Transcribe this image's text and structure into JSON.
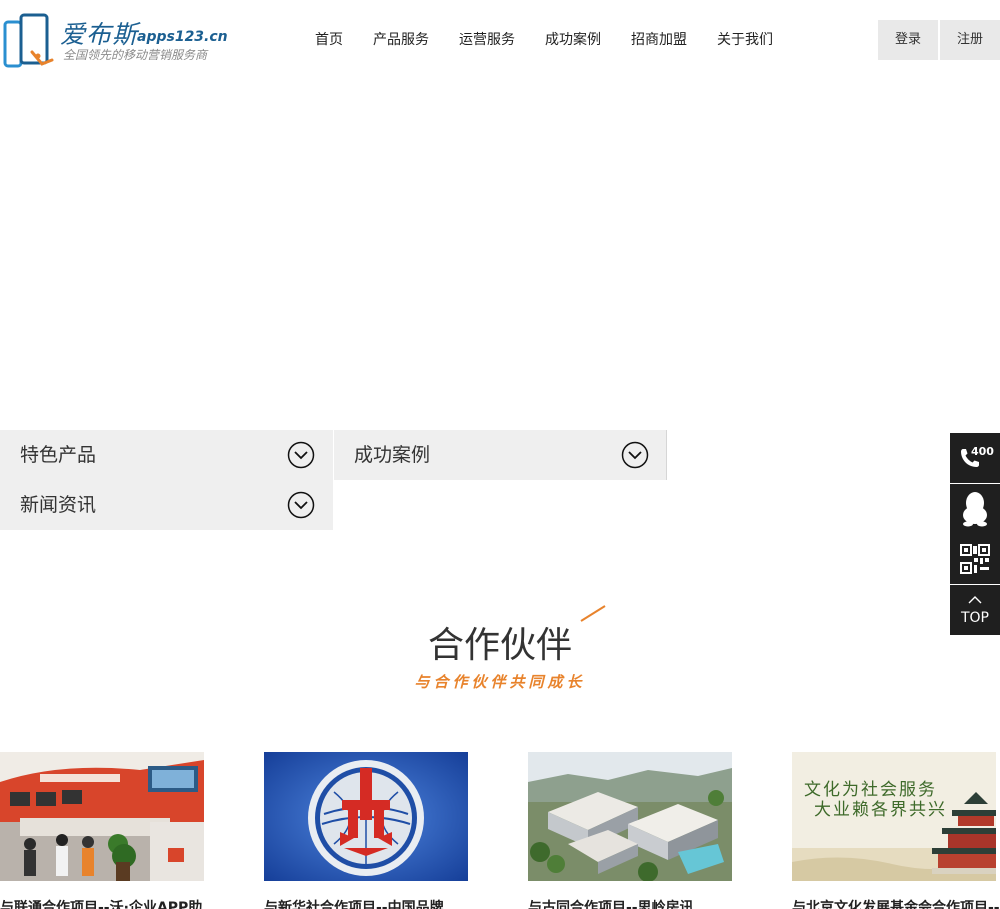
{
  "brand": {
    "name": "爱布斯",
    "domain": "apps123.cn",
    "slogan": "全国领先的移动营销服务商",
    "primary_color": "#1b5f91",
    "accent_color": "#e8832c"
  },
  "nav": [
    {
      "label": "首页"
    },
    {
      "label": "产品服务"
    },
    {
      "label": "运营服务"
    },
    {
      "label": "成功案例"
    },
    {
      "label": "招商加盟"
    },
    {
      "label": "关于我们"
    }
  ],
  "auth": {
    "login": "登录",
    "register": "注册"
  },
  "tabs": [
    {
      "label": "特色产品",
      "icon": "chevron-down-icon"
    },
    {
      "label": "成功案例",
      "icon": "chevron-down-icon"
    },
    {
      "label": "新闻资讯",
      "icon": "chevron-down-icon"
    }
  ],
  "float_bar": {
    "phone": {
      "icon": "phone-icon",
      "text": "400"
    },
    "qq": {
      "icon": "qq-penguin-icon"
    },
    "qr": {
      "icon": "qr-code-icon"
    },
    "top": {
      "icon": "arrow-up-icon",
      "text": "TOP"
    }
  },
  "partners": {
    "title": "合作伙伴",
    "subtitle": "与合作伙伴共同成长",
    "cards": [
      {
        "title": "与联通合作项目--沃·企业APP助"
      },
      {
        "title": "与新华社合作项目--中国品牌"
      },
      {
        "title": "与古同合作项目--思岭房讯"
      },
      {
        "title": "与北京文化发展基金会合作项目--",
        "image_text_1": "文化为社会服务",
        "image_text_2": "大业赖各界共兴"
      }
    ]
  }
}
